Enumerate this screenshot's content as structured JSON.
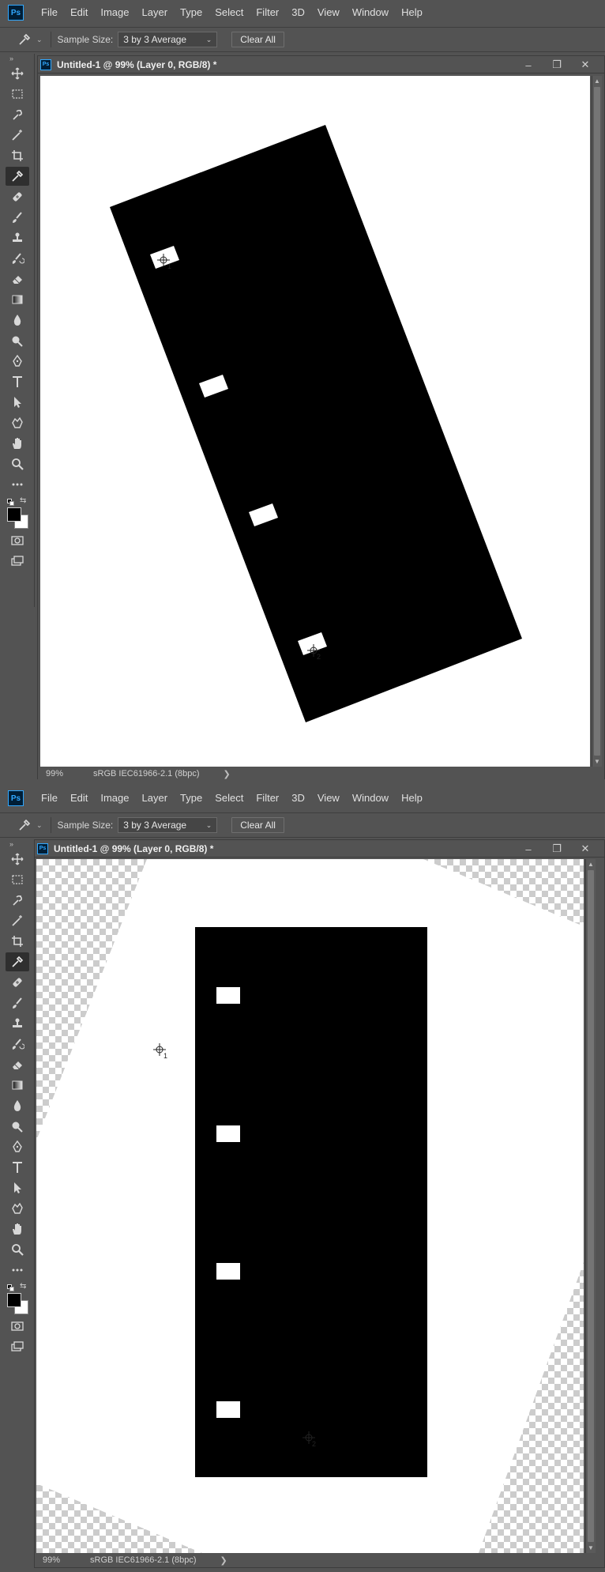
{
  "app": {
    "logo": "Ps"
  },
  "menu": [
    "File",
    "Edit",
    "Image",
    "Layer",
    "Type",
    "Select",
    "Filter",
    "3D",
    "View",
    "Window",
    "Help"
  ],
  "options": {
    "tool_icon": "eyedropper-icon",
    "sample_size_label": "Sample Size:",
    "sample_size_value": "3 by 3 Average",
    "clear_all": "Clear All"
  },
  "toolbar": {
    "tools": [
      "move-tool-icon",
      "rectangular-marquee-icon",
      "quick-selection-icon",
      "magic-wand-icon",
      "crop-tool-icon",
      "color-sampler-icon",
      "healing-brush-icon",
      "brush-tool-icon",
      "clone-stamp-icon",
      "history-brush-icon",
      "eraser-icon",
      "gradient-icon",
      "blur-tool-icon",
      "dodge-tool-icon",
      "pen-tool-icon",
      "type-tool-icon",
      "path-selection-icon",
      "custom-shape-icon",
      "hand-tool-icon",
      "zoom-tool-icon",
      "more-tools-icon"
    ],
    "active_tool": "color-sampler-icon",
    "foreground_color": "#000000",
    "background_color": "#ffffff"
  },
  "document": {
    "title": "Untitled-1 @ 99% (Layer 0, RGB/8) *",
    "zoom": "99%",
    "color_profile": "sRGB IEC61966-2.1 (8bpc)",
    "status_arrow": "❯",
    "ctrl_minimize": "–",
    "ctrl_restore": "❐",
    "ctrl_close": "✕"
  },
  "samplers": {
    "one": "1",
    "two": "2"
  }
}
